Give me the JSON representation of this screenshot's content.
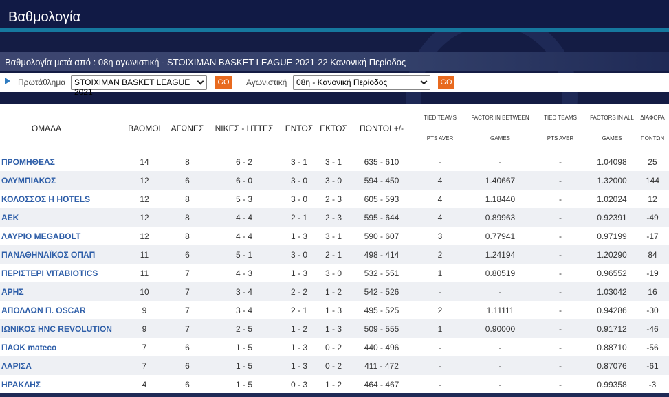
{
  "page": {
    "title": "Βαθμολογία"
  },
  "subtitle": "Βαθμολογία μετά από : 08η αγωνιστική - STOIXIMAN BASKET LEAGUE 2021-22 Κανονική Περίοδος",
  "filters": {
    "championship_label": "Πρωτάθλημα",
    "championship_value": "STOIXIMAN BASKET LEAGUE 2021",
    "round_label": "Αγωνιστική",
    "round_value": "08η - Κανονική Περίοδος",
    "go_label": "GO"
  },
  "table": {
    "headers": {
      "team": "ΟΜΑΔΑ",
      "points": "ΒΑΘΜΟΙ",
      "games": "ΑΓΩΝΕΣ",
      "wins_losses": "ΝΙΚΕΣ - ΗΤΤΕΣ",
      "home": "ΕΝΤΟΣ",
      "away": "ΕΚΤΟΣ",
      "points_diff": "ΠΟΝΤΟΙ +/-",
      "tied_pts_1": "TIED TEAMS",
      "tied_pts_2": "PTS AVER",
      "factor_between_1": "FACTOR IN BETWEEN",
      "factor_between_2": "GAMES",
      "tied_pts2_1": "TIED TEAMS",
      "tied_pts2_2": "PTS AVER",
      "factor_all_1": "FACTORS IN ALL",
      "factor_all_2": "GAMES",
      "diff_1": "ΔΙΑΦΟΡΑ",
      "diff_2": "ΠΟΝΤΩΝ"
    },
    "rows": [
      [
        "ΠΡΟΜΗΘΕΑΣ",
        "14",
        "8",
        "6 - 2",
        "3 - 1",
        "3 - 1",
        "635 - 610",
        "-",
        "-",
        "-",
        "1.04098",
        "25"
      ],
      [
        "ΟΛΥΜΠΙΑΚΟΣ",
        "12",
        "6",
        "6 - 0",
        "3 - 0",
        "3 - 0",
        "594 - 450",
        "4",
        "1.40667",
        "-",
        "1.32000",
        "144"
      ],
      [
        "ΚΟΛΟΣΣΟΣ Η HOTELS",
        "12",
        "8",
        "5 - 3",
        "3 - 0",
        "2 - 3",
        "605 - 593",
        "4",
        "1.18440",
        "-",
        "1.02024",
        "12"
      ],
      [
        "ΑΕΚ",
        "12",
        "8",
        "4 - 4",
        "2 - 1",
        "2 - 3",
        "595 - 644",
        "4",
        "0.89963",
        "-",
        "0.92391",
        "-49"
      ],
      [
        "ΛΑΥΡΙΟ MEGABOLT",
        "12",
        "8",
        "4 - 4",
        "1 - 3",
        "3 - 1",
        "590 - 607",
        "3",
        "0.77941",
        "-",
        "0.97199",
        "-17"
      ],
      [
        "ΠΑΝΑΘΗΝΑΪΚΟΣ ΟΠΑΠ",
        "11",
        "6",
        "5 - 1",
        "3 - 0",
        "2 - 1",
        "498 - 414",
        "2",
        "1.24194",
        "-",
        "1.20290",
        "84"
      ],
      [
        "ΠΕΡΙΣΤΕΡΙ VITABIOTICS",
        "11",
        "7",
        "4 - 3",
        "1 - 3",
        "3 - 0",
        "532 - 551",
        "1",
        "0.80519",
        "-",
        "0.96552",
        "-19"
      ],
      [
        "ΑΡΗΣ",
        "10",
        "7",
        "3 - 4",
        "2 - 2",
        "1 - 2",
        "542 - 526",
        "-",
        "-",
        "-",
        "1.03042",
        "16"
      ],
      [
        "ΑΠΟΛΛΩΝ Π. OSCAR",
        "9",
        "7",
        "3 - 4",
        "2 - 1",
        "1 - 3",
        "495 - 525",
        "2",
        "1.11111",
        "-",
        "0.94286",
        "-30"
      ],
      [
        "ΙΩΝΙΚΟΣ HNC REVOLUTION",
        "9",
        "7",
        "2 - 5",
        "1 - 2",
        "1 - 3",
        "509 - 555",
        "1",
        "0.90000",
        "-",
        "0.91712",
        "-46"
      ],
      [
        "ΠΑΟΚ mateco",
        "7",
        "6",
        "1 - 5",
        "1 - 3",
        "0 - 2",
        "440 - 496",
        "-",
        "-",
        "-",
        "0.88710",
        "-56"
      ],
      [
        "ΛΑΡΙΣΑ",
        "7",
        "6",
        "1 - 5",
        "1 - 3",
        "0 - 2",
        "411 - 472",
        "-",
        "-",
        "-",
        "0.87076",
        "-61"
      ],
      [
        "ΗΡΑΚΛΗΣ",
        "4",
        "6",
        "1 - 5",
        "0 - 3",
        "1 - 2",
        "464 - 467",
        "-",
        "-",
        "-",
        "0.99358",
        "-3"
      ]
    ]
  }
}
